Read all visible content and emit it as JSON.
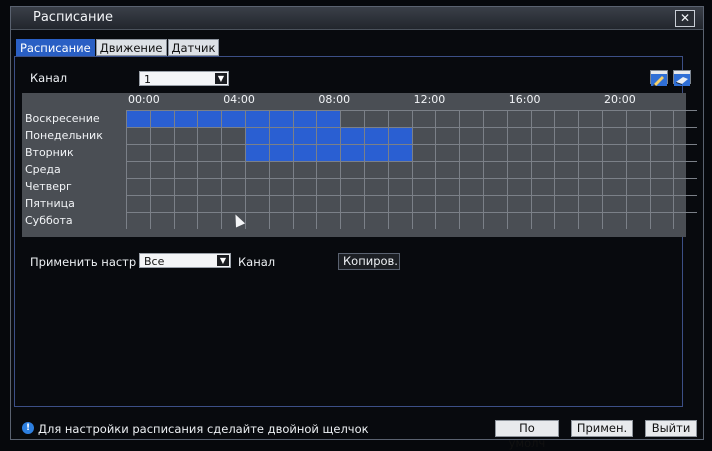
{
  "window": {
    "title": "Расписание",
    "close_glyph": "✕"
  },
  "tabs": [
    {
      "label": "Расписание",
      "active": true
    },
    {
      "label": "Движение",
      "active": false
    },
    {
      "label": "Датчик",
      "active": false
    }
  ],
  "channel": {
    "label": "Канал",
    "value": "1"
  },
  "tools": {
    "edit_icon": "pencil-icon",
    "erase_icon": "eraser-icon"
  },
  "schedule": {
    "hour_labels": [
      "00:00",
      "04:00",
      "08:00",
      "12:00",
      "16:00",
      "20:00"
    ],
    "days": [
      {
        "name": "Воскресение",
        "on": [
          [
            0,
            9
          ]
        ]
      },
      {
        "name": "Понедельник",
        "on": [
          [
            5,
            12
          ]
        ]
      },
      {
        "name": "Вторник",
        "on": [
          [
            5,
            12
          ]
        ]
      },
      {
        "name": "Среда",
        "on": []
      },
      {
        "name": "Четверг",
        "on": []
      },
      {
        "name": "Пятница",
        "on": []
      },
      {
        "name": "Суббота",
        "on": []
      }
    ],
    "active_color": "#2a5fd2"
  },
  "apply": {
    "label": "Применить настр",
    "target_value": "Все",
    "channel_label": "Канал",
    "copy_button": "Копиров."
  },
  "footer": {
    "hint": "Для настройки расписания сделайте двойной щелчок",
    "default_button": "По умолч",
    "apply_button": "Примен.",
    "exit_button": "Выйти"
  }
}
